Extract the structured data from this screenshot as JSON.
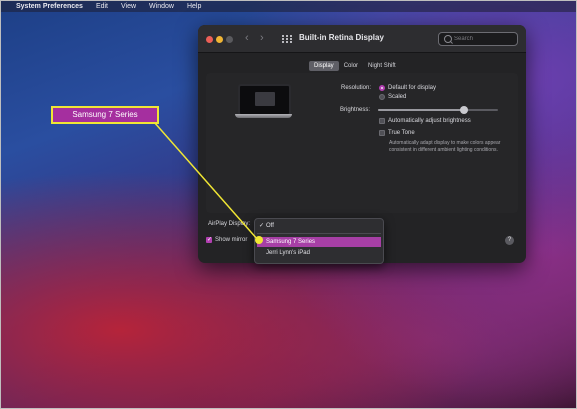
{
  "menubar": {
    "apple_icon": "apple-logo-icon",
    "app_name": "System Preferences",
    "items": [
      "Edit",
      "View",
      "Window",
      "Help"
    ]
  },
  "window": {
    "title": "Built-in Retina Display",
    "search_placeholder": "Search",
    "tabs": [
      {
        "label": "Display",
        "active": true
      },
      {
        "label": "Color",
        "active": false
      },
      {
        "label": "Night Shift",
        "active": false
      }
    ],
    "resolution": {
      "label": "Resolution:",
      "options": [
        {
          "label": "Default for display",
          "selected": true
        },
        {
          "label": "Scaled",
          "selected": false
        }
      ]
    },
    "brightness": {
      "label": "Brightness:",
      "level": 0.72
    },
    "auto_adjust": {
      "label": "Automatically adjust brightness",
      "checked": false
    },
    "true_tone": {
      "label": "True Tone",
      "checked": false,
      "description": "Automatically adapt display to make colors appear consistent in different ambient lighting conditions."
    },
    "airplay_label": "AirPlay Display:",
    "show_mirroring_label": "Show mirror",
    "help_label": "?"
  },
  "airplay_dropdown": {
    "items": [
      {
        "label": "Off",
        "checked": true,
        "highlighted": false
      },
      {
        "label": "Samsung 7 Series",
        "checked": false,
        "highlighted": true
      },
      {
        "label": "Jerri Lynn's iPad",
        "checked": false,
        "highlighted": false
      }
    ]
  },
  "callout": {
    "label": "Samsung 7 Series"
  },
  "colors": {
    "accent": "#a73fa6",
    "callout_border": "#f0e634",
    "window_bg": "#232325"
  }
}
